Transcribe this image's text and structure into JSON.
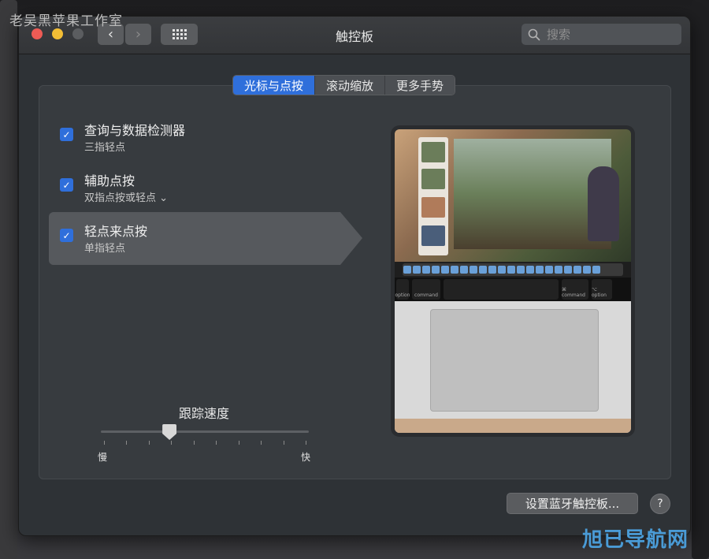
{
  "watermark": {
    "top": "老吴黑苹果工作室",
    "bottom_right": "旭已导航网"
  },
  "window": {
    "title": "触控板",
    "search_placeholder": "搜索",
    "nav_back_glyph": "‹",
    "nav_forward_glyph": "›"
  },
  "tabs": [
    {
      "label": "光标与点按",
      "active": true
    },
    {
      "label": "滚动缩放",
      "active": false
    },
    {
      "label": "更多手势",
      "active": false
    }
  ],
  "options": [
    {
      "label": "查询与数据检测器",
      "sub": "三指轻点",
      "checked": true
    },
    {
      "label": "辅助点按",
      "sub": "双指点按或轻点 ⌄",
      "checked": true
    },
    {
      "label": "轻点来点按",
      "sub": "单指轻点",
      "checked": true
    }
  ],
  "tracking": {
    "title": "跟踪速度",
    "slow": "慢",
    "fast": "快",
    "value_fraction": 0.33
  },
  "preview": {
    "keys": [
      "option",
      "command",
      "⌘ command",
      "⌥ option"
    ]
  },
  "buttons": {
    "bluetooth": "设置蓝牙触控板...",
    "help": "?"
  }
}
